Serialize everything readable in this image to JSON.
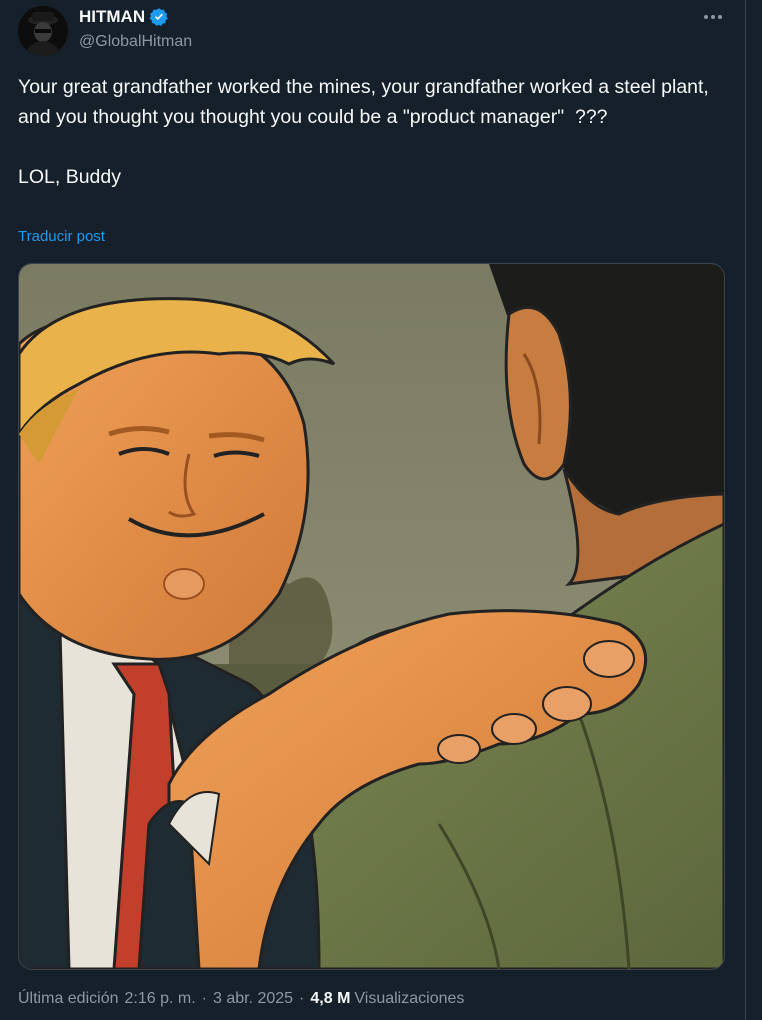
{
  "author": {
    "display_name": "HITMAN",
    "handle": "@GlobalHitman",
    "verified": true,
    "avatar_icon": "masked-figure-avatar"
  },
  "post": {
    "text": "Your great grandfather worked the mines, your grandfather worked a steel plant, and you thought you thought you could be a \"product manager\"  ???\n\nLOL, Buddy",
    "translate_label": "Traducir post",
    "media_icon": "cartoon-illustration-image"
  },
  "meta": {
    "edited_label": "Última edición",
    "time": "2:16 p. m.",
    "separator": "·",
    "date": "3 abr. 2025",
    "views_count": "4,8 M",
    "views_label": "Visualizaciones"
  },
  "colors": {
    "background": "#15202b",
    "accent": "#1d9bf0",
    "text_primary": "#f7f9f9",
    "text_secondary": "#8b98a5",
    "border": "#38444d"
  },
  "icons": {
    "verified": "verified-badge-icon",
    "more": "more-options-icon"
  }
}
